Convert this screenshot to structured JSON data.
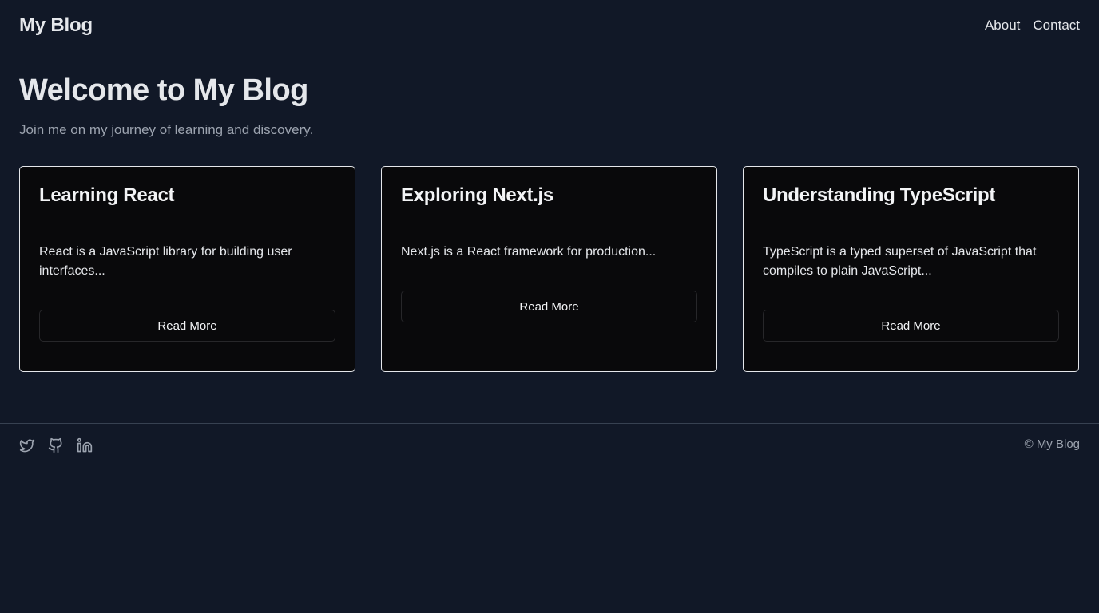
{
  "header": {
    "brand": "My Blog",
    "nav": [
      {
        "label": "About"
      },
      {
        "label": "Contact"
      }
    ]
  },
  "hero": {
    "title": "Welcome to My Blog",
    "subtitle": "Join me on my journey of learning and discovery."
  },
  "posts": [
    {
      "title": "Learning React",
      "excerpt": "React is a JavaScript library for building user interfaces...",
      "button": "Read More"
    },
    {
      "title": "Exploring Next.js",
      "excerpt": "Next.js is a React framework for production...",
      "button": "Read More"
    },
    {
      "title": "Understanding TypeScript",
      "excerpt": "TypeScript is a typed superset of JavaScript that compiles to plain JavaScript...",
      "button": "Read More"
    }
  ],
  "footer": {
    "social_icons": [
      "twitter-icon",
      "github-icon",
      "linkedin-icon"
    ],
    "copyright": "© My Blog"
  },
  "colors": {
    "background": "#111827",
    "card_background": "#09090b",
    "card_border": "#e5e7eb",
    "muted_text": "#9ca3af"
  }
}
